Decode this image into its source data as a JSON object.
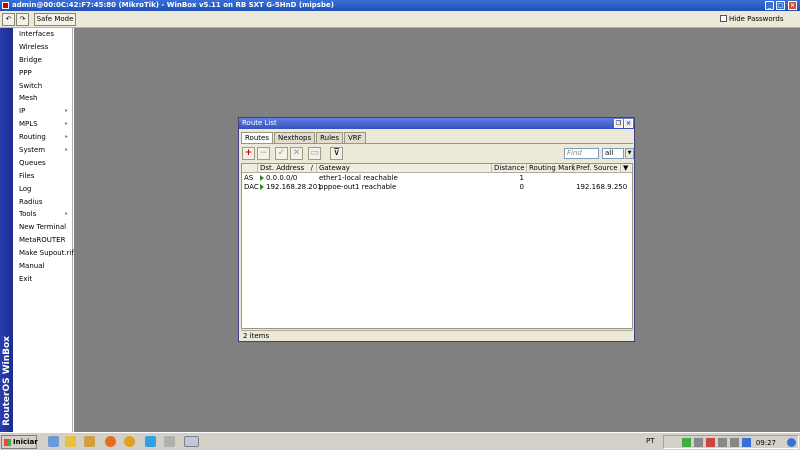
{
  "window": {
    "title": "admin@00:0C:42:F7:45:80 (MikroTik) - WinBox v5.11 on RB SXT G-5HnD (mipsbe)",
    "min_glyph": "_",
    "max_glyph": "□",
    "close_glyph": "×"
  },
  "toolbar": {
    "back_glyph": "↶",
    "forward_glyph": "↷",
    "safe_mode_label": "Safe Mode",
    "hide_passwords_label": "Hide Passwords"
  },
  "sidebar": {
    "brand": "RouterOS WinBox",
    "items": [
      {
        "label": "Interfaces",
        "submenu": false
      },
      {
        "label": "Wireless",
        "submenu": false
      },
      {
        "label": "Bridge",
        "submenu": false
      },
      {
        "label": "PPP",
        "submenu": false
      },
      {
        "label": "Switch",
        "submenu": false
      },
      {
        "label": "Mesh",
        "submenu": false
      },
      {
        "label": "IP",
        "submenu": true
      },
      {
        "label": "MPLS",
        "submenu": true
      },
      {
        "label": "Routing",
        "submenu": true
      },
      {
        "label": "System",
        "submenu": true
      },
      {
        "label": "Queues",
        "submenu": false
      },
      {
        "label": "Files",
        "submenu": false
      },
      {
        "label": "Log",
        "submenu": false
      },
      {
        "label": "Radius",
        "submenu": false
      },
      {
        "label": "Tools",
        "submenu": true
      },
      {
        "label": "New Terminal",
        "submenu": false
      },
      {
        "label": "MetaROUTER",
        "submenu": false
      },
      {
        "label": "Make Supout.rif",
        "submenu": false
      },
      {
        "label": "Manual",
        "submenu": false
      },
      {
        "label": "Exit",
        "submenu": false
      }
    ],
    "submenu_glyph": "▸"
  },
  "route_list": {
    "title": "Route List",
    "restore_glyph": "❐",
    "close_glyph": "×",
    "tabs": [
      "Routes",
      "Nexthops",
      "Rules",
      "VRF"
    ],
    "active_tab": "Routes",
    "find_placeholder": "Find",
    "filter_value": "all",
    "filter_glyph": "▼",
    "tool_glyphs": {
      "add": "+",
      "remove": "−",
      "enable": "✓",
      "disable": "✕",
      "comment": "▭",
      "filter": "⊽"
    },
    "columns": [
      "",
      "Dst. Address",
      "Gateway",
      "Distance",
      "Routing Mark",
      "Pref. Source"
    ],
    "sort_glyph": "/",
    "menu_glyph": "▼",
    "rows": [
      {
        "flags": "AS",
        "dst": "0.0.0.0/0",
        "gateway": "ether1-local reachable",
        "distance": "1",
        "routing_mark": "",
        "pref_source": ""
      },
      {
        "flags": "DAC",
        "dst": "192.168.28.201",
        "gateway": "pppoe-out1 reachable",
        "distance": "0",
        "routing_mark": "",
        "pref_source": "192.168.9.250"
      }
    ],
    "status": "2 items"
  },
  "taskbar": {
    "start_label": "Iniciar",
    "language": "PT",
    "clock": "09:27"
  }
}
